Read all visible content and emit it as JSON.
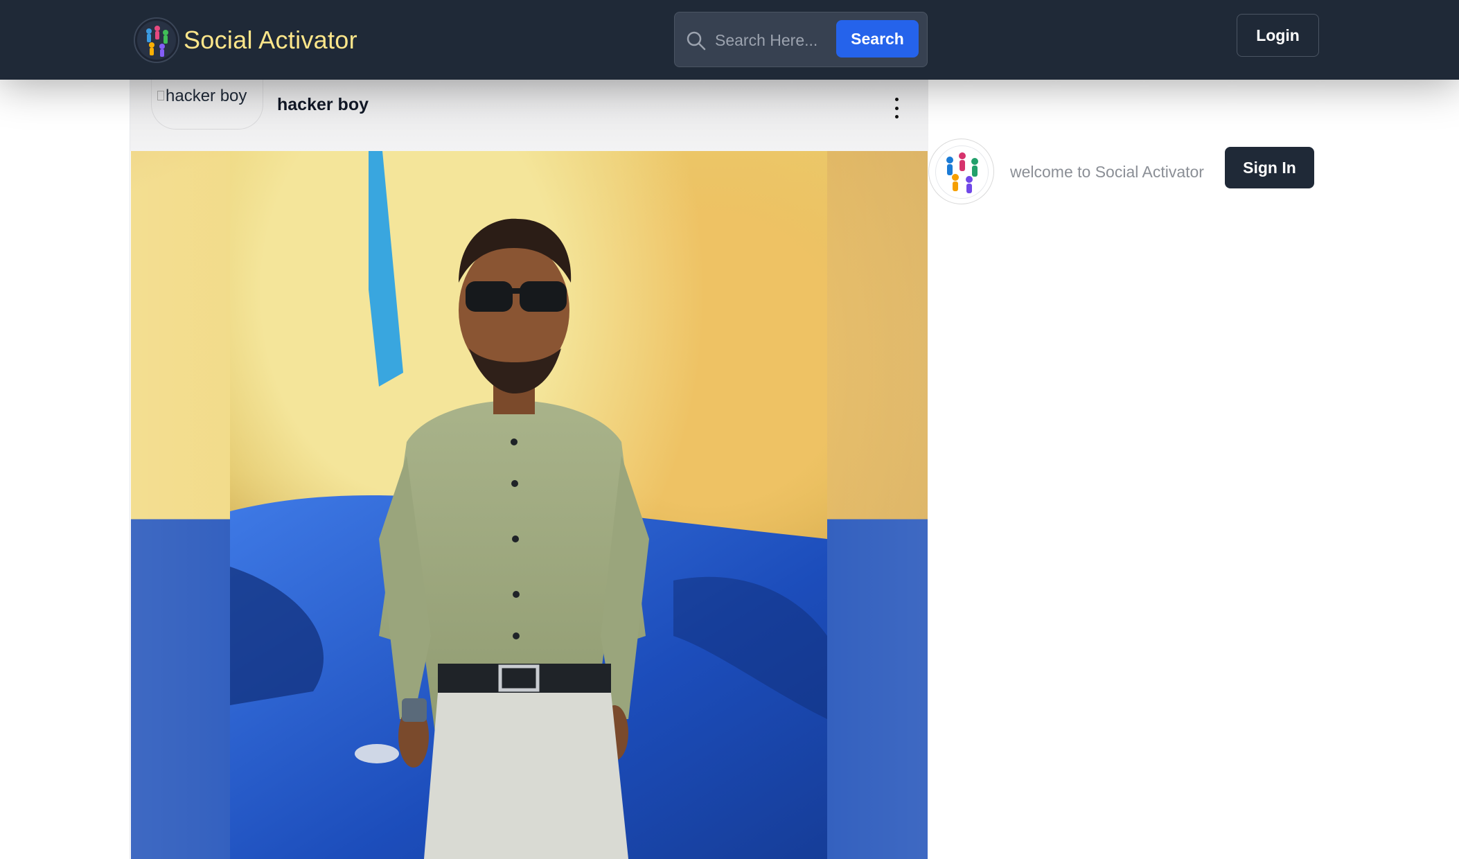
{
  "header": {
    "brand_name": "Social Activator",
    "brand_logo_icon": "globe-people-icon",
    "search": {
      "placeholder": "Search Here...",
      "button_label": "Search",
      "icon": "search-icon"
    },
    "login_label": "Login"
  },
  "post": {
    "avatar_alt": "hacker boy",
    "author_name": "hacker boy",
    "menu_icon": "more-vertical-icon",
    "photo_alt": "man in green shirt and sunglasses leaning on blue car"
  },
  "sidebar": {
    "logo_icon": "globe-people-icon",
    "welcome_text": "welcome to Social Activator",
    "signin_label": "Sign In"
  },
  "colors": {
    "navbar_bg": "#1f2937",
    "brand_text": "#fde68a",
    "search_button": "#2563eb",
    "signin_button": "#1f2937"
  }
}
